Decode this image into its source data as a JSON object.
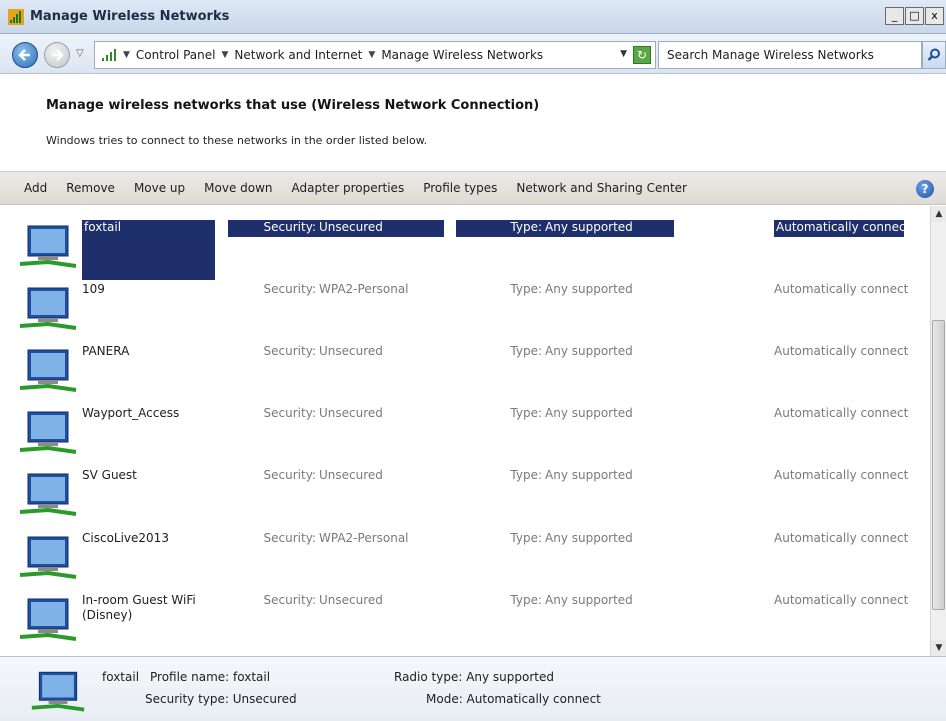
{
  "window": {
    "title": "Manage Wireless Networks",
    "controls": {
      "minimize": "_",
      "maximize": "□",
      "close": "x"
    }
  },
  "address": {
    "breadcrumbs": [
      "Control Panel",
      "Network and Internet",
      "Manage Wireless Networks"
    ],
    "search_placeholder": "Search Manage Wireless Networks"
  },
  "header": {
    "title": "Manage wireless networks that use (Wireless Network Connection)",
    "subtitle": "Windows tries to connect to these networks in the order listed below."
  },
  "toolbar": {
    "items": [
      "Add",
      "Remove",
      "Move up",
      "Move down",
      "Adapter properties",
      "Profile types",
      "Network and Sharing Center"
    ]
  },
  "list": {
    "security_label": "Security:",
    "type_label": "Type:",
    "networks": [
      {
        "name": "foxtail",
        "security": "Unsecured",
        "type": "Any supported",
        "mode": "Automatically connect",
        "selected": true
      },
      {
        "name": "109",
        "security": "WPA2-Personal",
        "type": "Any supported",
        "mode": "Automatically connect",
        "selected": false
      },
      {
        "name": "PANERA",
        "security": "Unsecured",
        "type": "Any supported",
        "mode": "Automatically connect",
        "selected": false
      },
      {
        "name": "Wayport_Access",
        "security": "Unsecured",
        "type": "Any supported",
        "mode": "Automatically connect",
        "selected": false
      },
      {
        "name": "SV Guest",
        "security": "Unsecured",
        "type": "Any supported",
        "mode": "Automatically connect",
        "selected": false
      },
      {
        "name": "CiscoLive2013",
        "security": "WPA2-Personal",
        "type": "Any supported",
        "mode": "Automatically connect",
        "selected": false
      },
      {
        "name": "In-room Guest WiFi (Disney)",
        "security": "Unsecured",
        "type": "Any supported",
        "mode": "Automatically connect",
        "selected": false
      }
    ]
  },
  "details": {
    "name": "foxtail",
    "profile_name": "Profile name: foxtail",
    "security_type": "Security type: Unsecured",
    "radio_type": "Radio type: Any supported",
    "mode": "Mode: Automatically connect"
  }
}
